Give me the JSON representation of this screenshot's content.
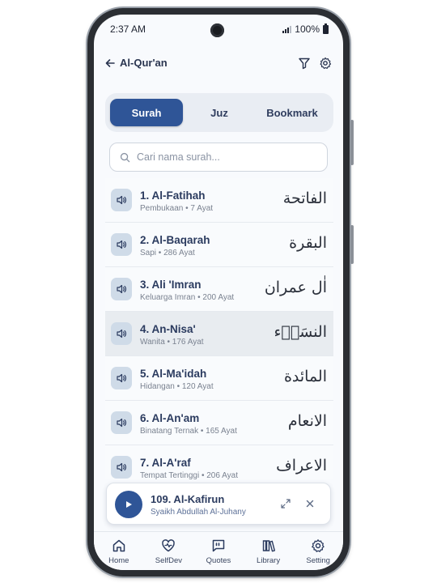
{
  "status_bar": {
    "time": "2:37 AM",
    "battery": "100%"
  },
  "appbar": {
    "title": "Al-Qur'an"
  },
  "tabs": [
    {
      "label": "Surah",
      "active": true
    },
    {
      "label": "Juz",
      "active": false
    },
    {
      "label": "Bookmark",
      "active": false
    }
  ],
  "search": {
    "placeholder": "Cari nama surah..."
  },
  "surahs": [
    {
      "name": "1. Al-Fatihah",
      "meta": "Pembukaan • 7 Ayat",
      "arabic": "الفاتحة"
    },
    {
      "name": "2. Al-Baqarah",
      "meta": "Sapi • 286 Ayat",
      "arabic": "البقرة"
    },
    {
      "name": "3. Ali 'Imran",
      "meta": "Keluarga Imran • 200 Ayat",
      "arabic": "اٰل عمران"
    },
    {
      "name": "4. An-Nisa'",
      "meta": "Wanita • 176 Ayat",
      "arabic": "النسَاۤء"
    },
    {
      "name": "5. Al-Ma'idah",
      "meta": "Hidangan • 120 Ayat",
      "arabic": "المائدة"
    },
    {
      "name": "6. Al-An'am",
      "meta": "Binatang Ternak • 165 Ayat",
      "arabic": "الانعام"
    },
    {
      "name": "7. Al-A'raf",
      "meta": "Tempat Tertinggi • 206 Ayat",
      "arabic": "الاعراف"
    }
  ],
  "player": {
    "title": "109. Al-Kafirun",
    "reciter": "Syaikh Abdullah Al-Juhany"
  },
  "bottom_nav": [
    {
      "label": "Home",
      "icon": "home-icon"
    },
    {
      "label": "SelfDev",
      "icon": "heart-pulse-icon"
    },
    {
      "label": "Quotes",
      "icon": "quote-icon"
    },
    {
      "label": "Library",
      "icon": "library-icon"
    },
    {
      "label": "Setting",
      "icon": "gear-icon"
    }
  ],
  "colors": {
    "primary": "#2f5597",
    "text": "#2b3b5f",
    "speaker_bg": "#cfdbe8"
  }
}
